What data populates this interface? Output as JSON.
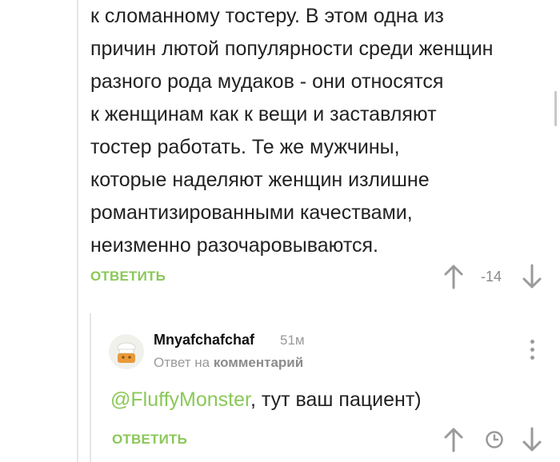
{
  "comment": {
    "lines": [
      "к сломанному тостеру. В этом одна из",
      "причин лютой популярности среди женщин",
      "разного рода мудаков - они относятся",
      "к женщинам как к вещи и заставляют",
      "тостер работать. Те же мужчины,",
      "которые наделяют женщин излишне",
      "романтизированными качествами,",
      "неизменно разочаровываются."
    ],
    "reply_label": "ОТВЕТИТЬ",
    "score": "-14"
  },
  "reply": {
    "author": "Mnyafchafchaf",
    "time": "51м",
    "meta_prefix": "Ответ на",
    "meta_link": "комментарий",
    "mention": "@FluffyMonster",
    "text": ", тут ваш пациент)",
    "reply_label": "ОТВЕТИТЬ"
  },
  "colors": {
    "accent": "#8ac858",
    "muted": "#9a9a9a",
    "text": "#222222"
  },
  "icons": [
    "arrow-up-icon",
    "arrow-down-icon",
    "clock-icon",
    "more-vertical-icon",
    "avatar-chef-icon"
  ]
}
